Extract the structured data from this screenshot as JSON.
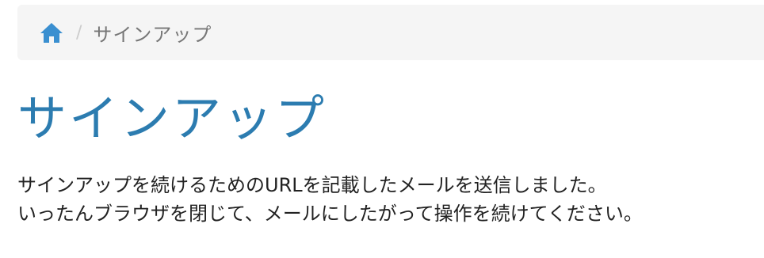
{
  "breadcrumb": {
    "home_icon": "home-icon",
    "separator": "/",
    "current": "サインアップ"
  },
  "colors": {
    "accent": "#2c7cb0",
    "home_icon": "#3a8fd0",
    "breadcrumb_bg": "#f5f5f5"
  },
  "main": {
    "title": "サインアップ",
    "message_line1": "サインアップを続けるためのURLを記載したメールを送信しました。",
    "message_line2": "いったんブラウザを閉じて、メールにしたがって操作を続けてください。"
  }
}
